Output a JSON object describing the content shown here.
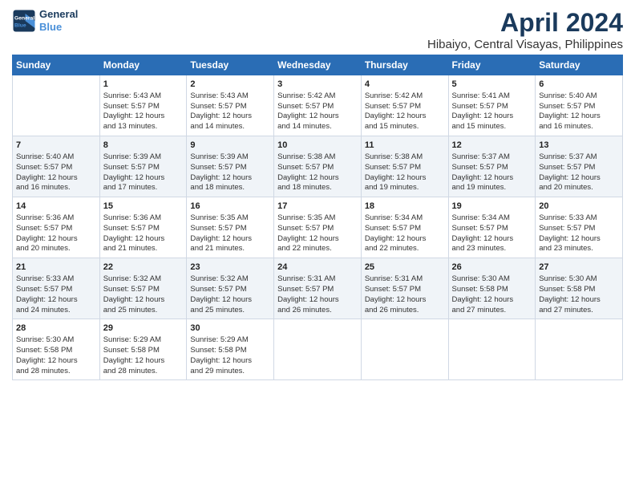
{
  "header": {
    "logo_line1": "General",
    "logo_line2": "Blue",
    "title": "April 2024",
    "subtitle": "Hibaiyo, Central Visayas, Philippines"
  },
  "columns": [
    "Sunday",
    "Monday",
    "Tuesday",
    "Wednesday",
    "Thursday",
    "Friday",
    "Saturday"
  ],
  "weeks": [
    [
      {
        "day": "",
        "info": ""
      },
      {
        "day": "1",
        "info": "Sunrise: 5:43 AM\nSunset: 5:57 PM\nDaylight: 12 hours\nand 13 minutes."
      },
      {
        "day": "2",
        "info": "Sunrise: 5:43 AM\nSunset: 5:57 PM\nDaylight: 12 hours\nand 14 minutes."
      },
      {
        "day": "3",
        "info": "Sunrise: 5:42 AM\nSunset: 5:57 PM\nDaylight: 12 hours\nand 14 minutes."
      },
      {
        "day": "4",
        "info": "Sunrise: 5:42 AM\nSunset: 5:57 PM\nDaylight: 12 hours\nand 15 minutes."
      },
      {
        "day": "5",
        "info": "Sunrise: 5:41 AM\nSunset: 5:57 PM\nDaylight: 12 hours\nand 15 minutes."
      },
      {
        "day": "6",
        "info": "Sunrise: 5:40 AM\nSunset: 5:57 PM\nDaylight: 12 hours\nand 16 minutes."
      }
    ],
    [
      {
        "day": "7",
        "info": "Sunrise: 5:40 AM\nSunset: 5:57 PM\nDaylight: 12 hours\nand 16 minutes."
      },
      {
        "day": "8",
        "info": "Sunrise: 5:39 AM\nSunset: 5:57 PM\nDaylight: 12 hours\nand 17 minutes."
      },
      {
        "day": "9",
        "info": "Sunrise: 5:39 AM\nSunset: 5:57 PM\nDaylight: 12 hours\nand 18 minutes."
      },
      {
        "day": "10",
        "info": "Sunrise: 5:38 AM\nSunset: 5:57 PM\nDaylight: 12 hours\nand 18 minutes."
      },
      {
        "day": "11",
        "info": "Sunrise: 5:38 AM\nSunset: 5:57 PM\nDaylight: 12 hours\nand 19 minutes."
      },
      {
        "day": "12",
        "info": "Sunrise: 5:37 AM\nSunset: 5:57 PM\nDaylight: 12 hours\nand 19 minutes."
      },
      {
        "day": "13",
        "info": "Sunrise: 5:37 AM\nSunset: 5:57 PM\nDaylight: 12 hours\nand 20 minutes."
      }
    ],
    [
      {
        "day": "14",
        "info": "Sunrise: 5:36 AM\nSunset: 5:57 PM\nDaylight: 12 hours\nand 20 minutes."
      },
      {
        "day": "15",
        "info": "Sunrise: 5:36 AM\nSunset: 5:57 PM\nDaylight: 12 hours\nand 21 minutes."
      },
      {
        "day": "16",
        "info": "Sunrise: 5:35 AM\nSunset: 5:57 PM\nDaylight: 12 hours\nand 21 minutes."
      },
      {
        "day": "17",
        "info": "Sunrise: 5:35 AM\nSunset: 5:57 PM\nDaylight: 12 hours\nand 22 minutes."
      },
      {
        "day": "18",
        "info": "Sunrise: 5:34 AM\nSunset: 5:57 PM\nDaylight: 12 hours\nand 22 minutes."
      },
      {
        "day": "19",
        "info": "Sunrise: 5:34 AM\nSunset: 5:57 PM\nDaylight: 12 hours\nand 23 minutes."
      },
      {
        "day": "20",
        "info": "Sunrise: 5:33 AM\nSunset: 5:57 PM\nDaylight: 12 hours\nand 23 minutes."
      }
    ],
    [
      {
        "day": "21",
        "info": "Sunrise: 5:33 AM\nSunset: 5:57 PM\nDaylight: 12 hours\nand 24 minutes."
      },
      {
        "day": "22",
        "info": "Sunrise: 5:32 AM\nSunset: 5:57 PM\nDaylight: 12 hours\nand 25 minutes."
      },
      {
        "day": "23",
        "info": "Sunrise: 5:32 AM\nSunset: 5:57 PM\nDaylight: 12 hours\nand 25 minutes."
      },
      {
        "day": "24",
        "info": "Sunrise: 5:31 AM\nSunset: 5:57 PM\nDaylight: 12 hours\nand 26 minutes."
      },
      {
        "day": "25",
        "info": "Sunrise: 5:31 AM\nSunset: 5:57 PM\nDaylight: 12 hours\nand 26 minutes."
      },
      {
        "day": "26",
        "info": "Sunrise: 5:30 AM\nSunset: 5:58 PM\nDaylight: 12 hours\nand 27 minutes."
      },
      {
        "day": "27",
        "info": "Sunrise: 5:30 AM\nSunset: 5:58 PM\nDaylight: 12 hours\nand 27 minutes."
      }
    ],
    [
      {
        "day": "28",
        "info": "Sunrise: 5:30 AM\nSunset: 5:58 PM\nDaylight: 12 hours\nand 28 minutes."
      },
      {
        "day": "29",
        "info": "Sunrise: 5:29 AM\nSunset: 5:58 PM\nDaylight: 12 hours\nand 28 minutes."
      },
      {
        "day": "30",
        "info": "Sunrise: 5:29 AM\nSunset: 5:58 PM\nDaylight: 12 hours\nand 29 minutes."
      },
      {
        "day": "",
        "info": ""
      },
      {
        "day": "",
        "info": ""
      },
      {
        "day": "",
        "info": ""
      },
      {
        "day": "",
        "info": ""
      }
    ]
  ]
}
